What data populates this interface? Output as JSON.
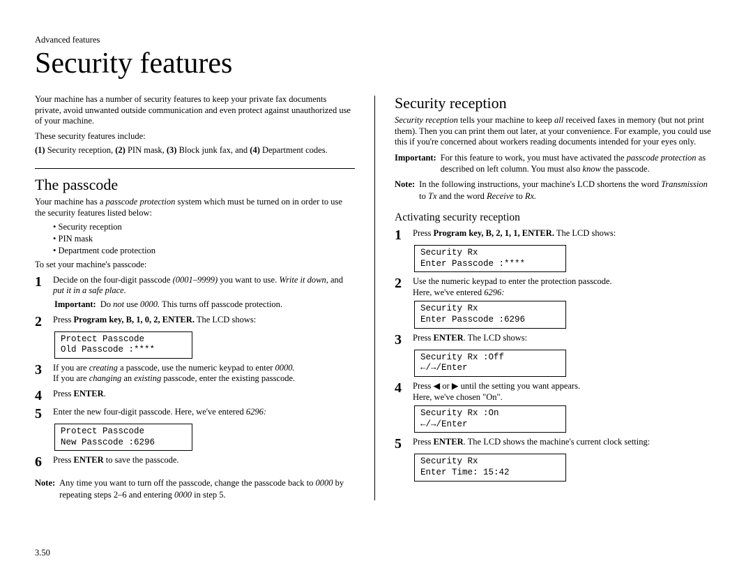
{
  "running_head": "Advanced features",
  "title": "Security features",
  "page_number": "3.50",
  "left": {
    "intro1": "Your machine has a number of security features to keep your private fax documents private, avoid unwanted outside communication and even protect against unauthorized use of your machine.",
    "intro2": "These security features include:",
    "intro3_pre": "(1) Security reception, (2) PIN mask, (3) Block junk fax, and (4) Department codes.",
    "h_passcode": "The passcode",
    "passcode_p": "Your machine has a passcode protection system which must be turned on in order to use the security features listed below:",
    "passcode_bullets": [
      "Security reception",
      "PIN mask",
      "Department code protection"
    ],
    "passcode_set": "To set your machine's passcode:",
    "step1": "Decide on the four-digit passcode (0001–9999) you want to use. Write it down, and put it in a safe place.",
    "step1_imp": "Do not use 0000. This turns off passcode protection.",
    "step2_pre": "Press ",
    "step2_key": "Program key, B, 1, 0, 2, ENTER.",
    "step2_post": " The LCD shows:",
    "lcd1_l1": "Protect Passcode",
    "lcd1_l2": "Old Passcode  :****",
    "step3_l1": "If you are creating a passcode, use the numeric keypad to enter 0000.",
    "step3_l2": "If you are changing an existing passcode, enter the existing passcode.",
    "step4": "Press ENTER.",
    "step5": "Enter the new four-digit passcode. Here, we've entered 6296:",
    "lcd2_l1": "Protect Passcode",
    "lcd2_l2": "New Passcode  :6296",
    "step6": "Press ENTER to save the passcode.",
    "note": "Any time you want to turn off the passcode, change the passcode back to 0000 by repeating steps 2–6 and entering 0000 in step 5."
  },
  "right": {
    "h_secrx": "Security reception",
    "p1": "Security reception tells your machine to keep all received faxes in memory (but not print them). Then you can print them out later, at your convenience. For example, you could use this if you're concerned about workers reading documents intended for your eyes only.",
    "imp": "For this feature to work, you must have activated the passcode protection as described on left column. You must also know the passcode.",
    "note": "In the following instructions, your machine's LCD shortens the word Transmission to Tx and the word Receive to Rx.",
    "h_act": "Activating security reception",
    "step1_pre": "Press ",
    "step1_key": "Program key, B, 2, 1, 1, ENTER.",
    "step1_post": " The LCD shows:",
    "lcd1_l1": "Security Rx",
    "lcd1_l2": "Enter Passcode :****",
    "step2_l1": "Use the numeric keypad to enter the protection passcode.",
    "step2_l2": "Here, we've entered 6296:",
    "lcd2_l1": "Security Rx",
    "lcd2_l2": "Enter Passcode :6296",
    "step3": "Press ENTER. The LCD shows:",
    "lcd3_l1": "Security Rx    :Off",
    "lcd3_l2": "      ←/→/Enter",
    "step4_l1": "Press ◀ or ▶ until the setting you want appears.",
    "step4_l2": "Here, we've chosen \"On\".",
    "lcd4_l1": "Security Rx    :On",
    "lcd4_l2": "      ←/→/Enter",
    "step5": "Press ENTER. The LCD shows the machine's current clock setting:",
    "lcd5_l1": "Security Rx",
    "lcd5_l2": "Enter Time:   15:42"
  },
  "labels": {
    "important": "Important:",
    "note": "Note:"
  }
}
